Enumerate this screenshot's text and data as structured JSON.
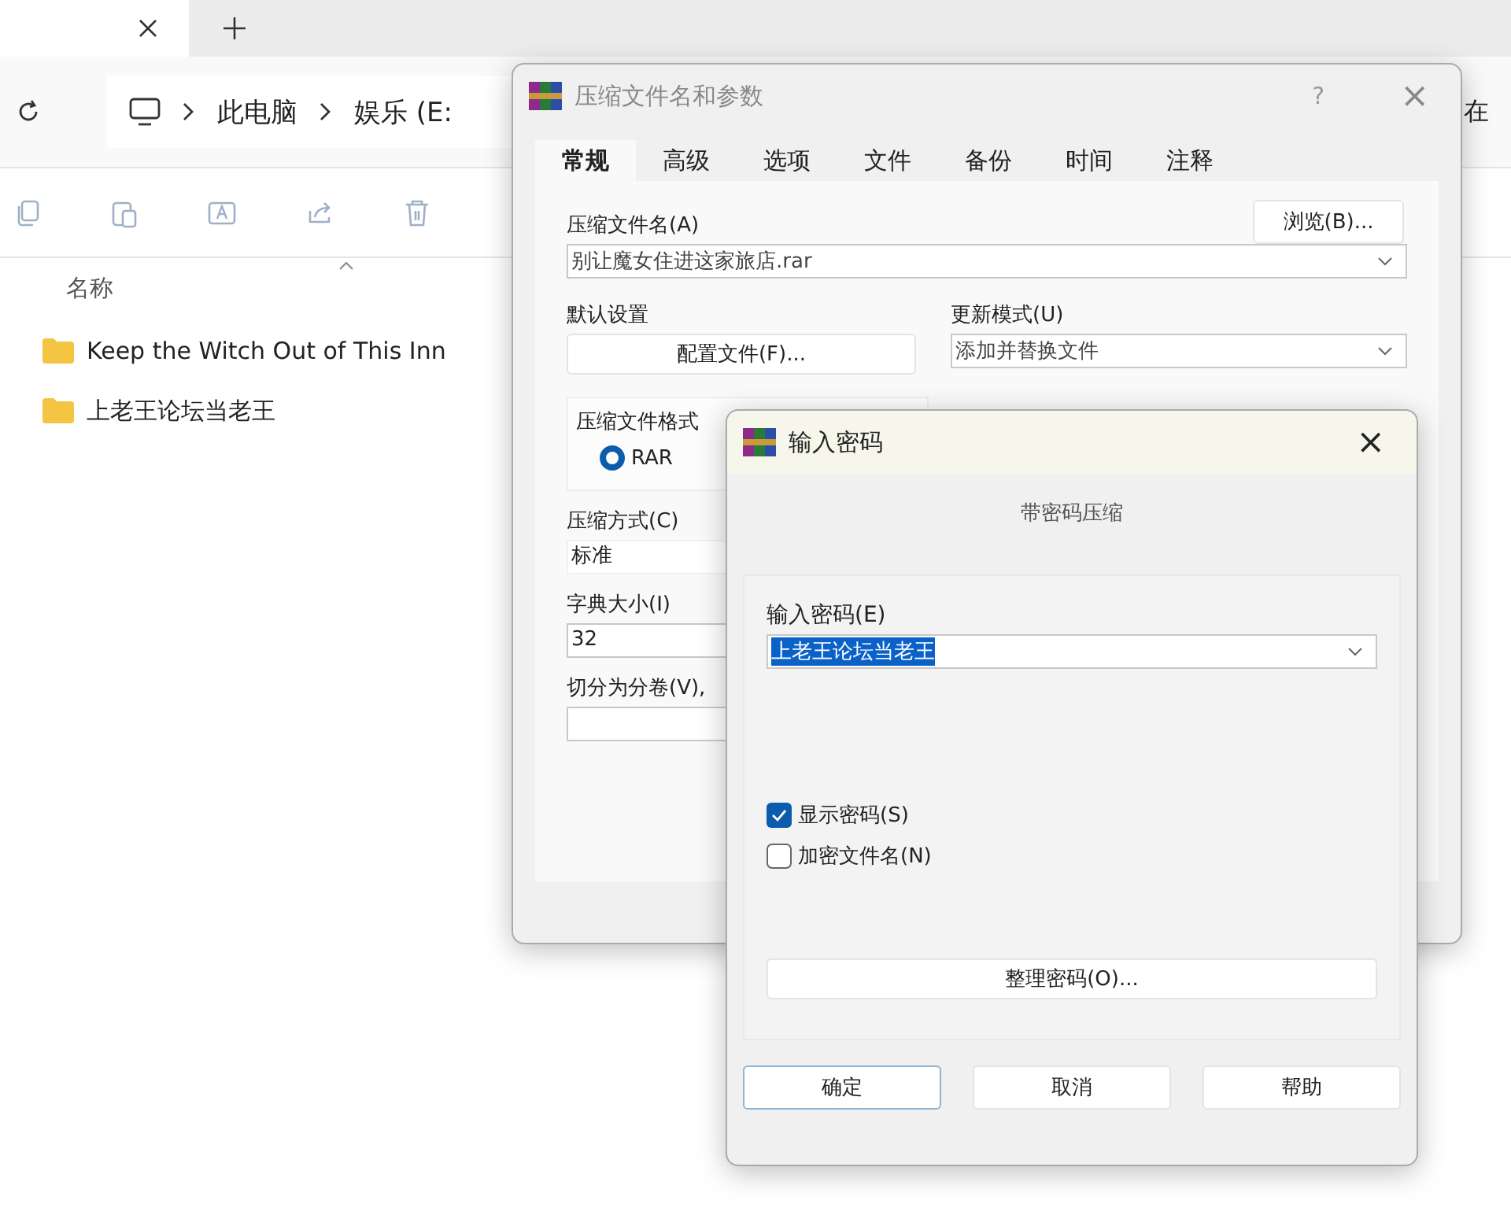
{
  "explorer": {
    "tabs": [
      {
        "kind": "close",
        "selected": true
      },
      {
        "kind": "new"
      }
    ],
    "address": {
      "crumbs": [
        "此电脑",
        "娱乐 (E:"
      ],
      "search_placeholder": "在"
    },
    "toolbar": [
      {
        "kind": "copy",
        "disabled": true
      },
      {
        "kind": "paste",
        "disabled": true
      },
      {
        "kind": "rename",
        "disabled": true
      },
      {
        "kind": "share",
        "disabled": true
      },
      {
        "kind": "delete",
        "disabled": true
      }
    ],
    "column": "名称",
    "files": [
      {
        "name": "Keep the Witch Out of This Inn"
      },
      {
        "name": "上老王论坛当老王"
      }
    ]
  },
  "archive_dialog": {
    "title": "压缩文件名和参数",
    "help": "?",
    "close": "×",
    "tabs": [
      {
        "label": "常规",
        "selected": true
      },
      {
        "label": "高级",
        "selected": false
      },
      {
        "label": "选项",
        "selected": false
      },
      {
        "label": "文件",
        "selected": false
      },
      {
        "label": "备份",
        "selected": false
      },
      {
        "label": "时间",
        "selected": false
      },
      {
        "label": "注释",
        "selected": false
      }
    ],
    "archive_name_label": "压缩文件名(A)",
    "browse_button": "浏览(B)...",
    "archive_name": "别让魔女住进这家旅店.rar",
    "defaults_label": "默认设置",
    "profiles_button": "配置文件(F)...",
    "update_label": "更新模式(U)",
    "update_mode": "添加并替换文件",
    "format_label": "压缩文件格式",
    "formats": [
      {
        "label": "RAR",
        "selected": true
      }
    ],
    "method_label": "压缩方式(C)",
    "method": "标准",
    "dict_label": "字典大小(I)",
    "dict": "32",
    "split_label": "切分为分卷(V),"
  },
  "password_dialog": {
    "title": "输入密码",
    "close": "×",
    "subtitle": "带密码压缩",
    "password_label": "输入密码(E)",
    "password": "上老王论坛当老王",
    "password_highlighted": true,
    "options": [
      {
        "label": "显示密码(S)",
        "checked": true
      },
      {
        "label": "加密文件名(N)",
        "checked": false
      }
    ],
    "organize_button": "整理密码(O)...",
    "buttons": [
      {
        "label": "确定",
        "selected": true
      },
      {
        "label": "取消",
        "selected": false
      },
      {
        "label": "帮助",
        "selected": false
      }
    ]
  }
}
